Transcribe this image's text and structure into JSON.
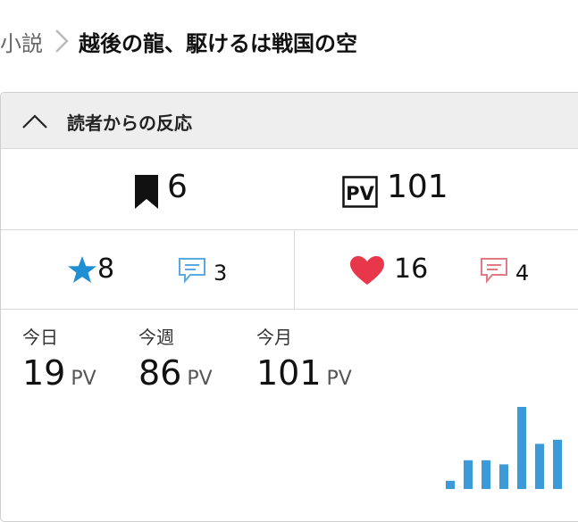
{
  "breadcrumb": {
    "root": "小説",
    "title": "越後の龍、駆けるは戦国の空"
  },
  "reactions": {
    "title": "読者からの反応",
    "bookmarks": "6",
    "pv_total": "101",
    "stars": "8",
    "star_comments": "3",
    "hearts": "16",
    "heart_comments": "4"
  },
  "pv_stats": [
    {
      "label": "今日",
      "value": "19",
      "unit": "PV"
    },
    {
      "label": "今週",
      "value": "86",
      "unit": "PV"
    },
    {
      "label": "今月",
      "value": "101",
      "unit": "PV"
    }
  ],
  "chart_data": {
    "type": "bar",
    "values": [
      2,
      7,
      7,
      6,
      20,
      11,
      12
    ],
    "color": "#3d9ad9"
  },
  "colors": {
    "star": "#1f8fd4",
    "heart": "#e8364b",
    "comment_blue": "#5aa9e0",
    "comment_red": "#e27a86"
  }
}
